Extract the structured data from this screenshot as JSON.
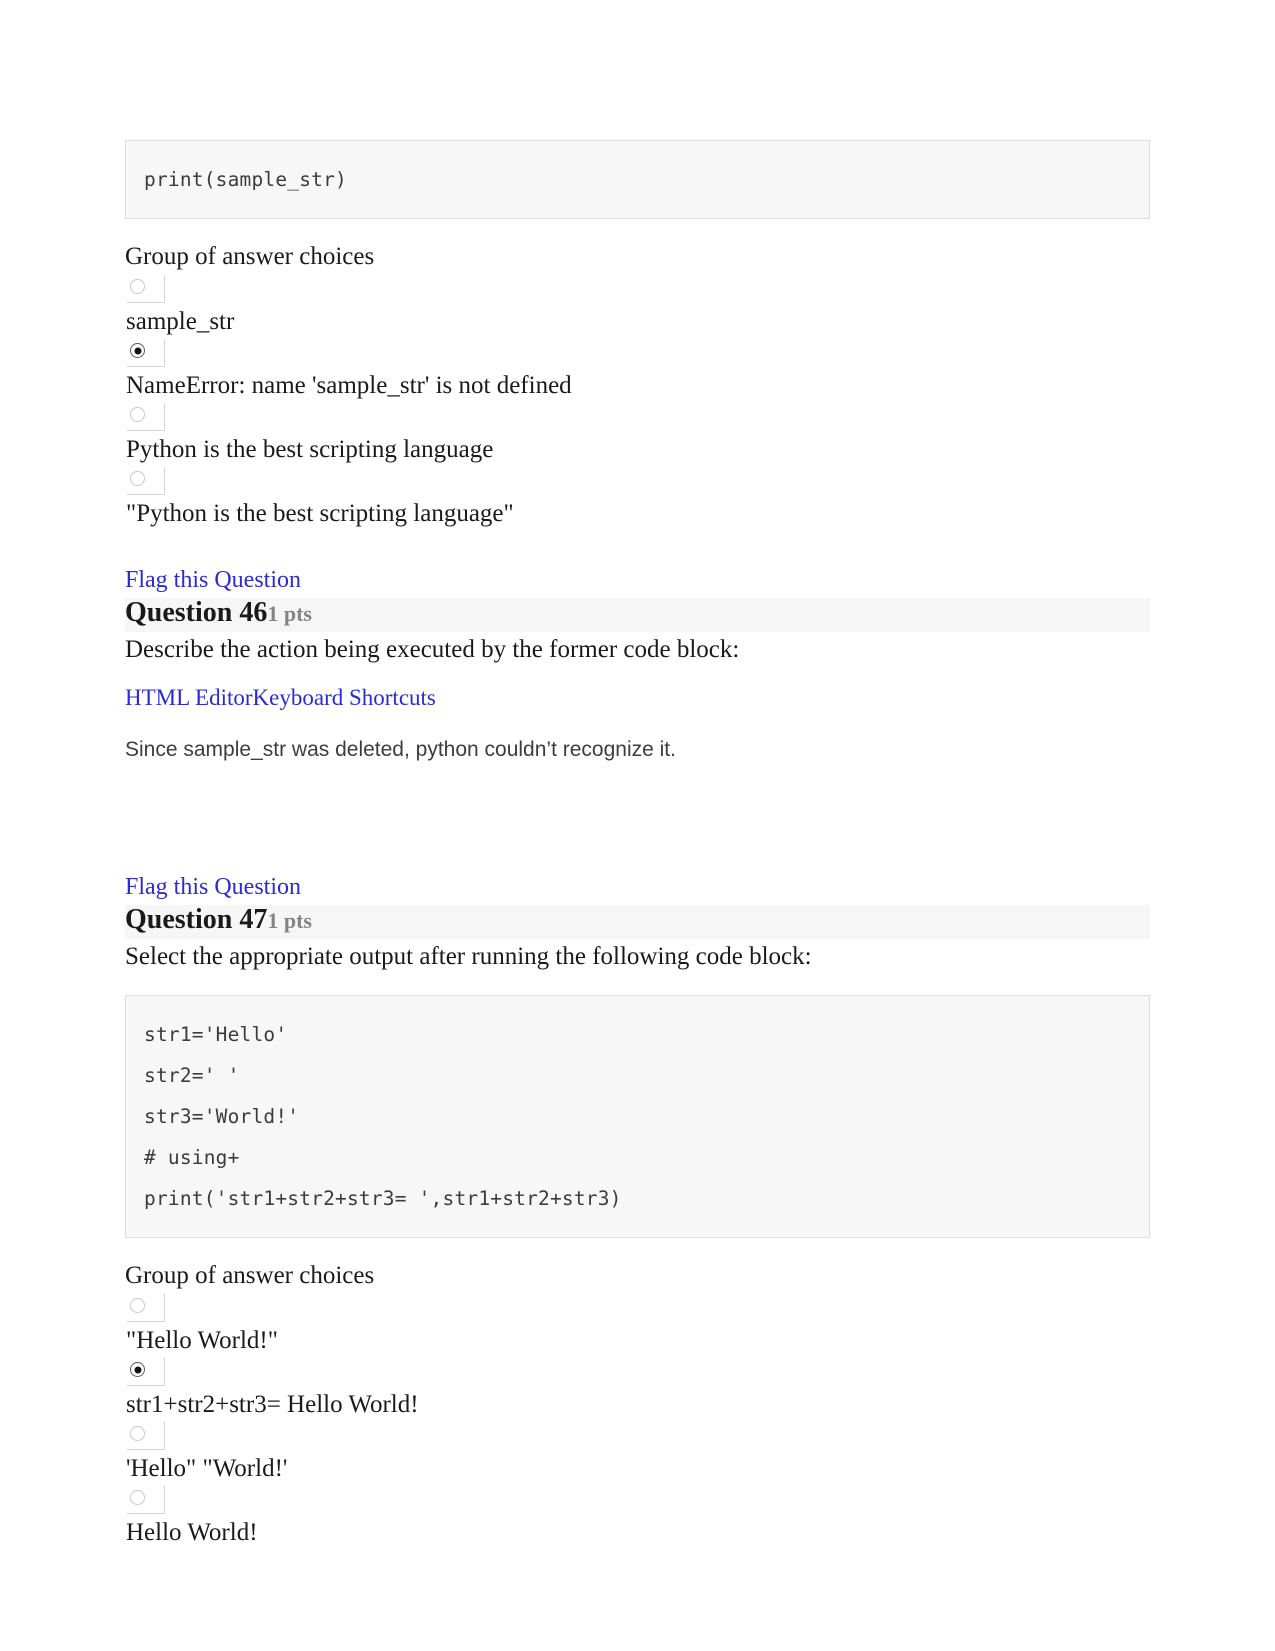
{
  "question45_tail": {
    "code_lines": [
      "print(sample_str)"
    ],
    "group_label": "Group of answer choices",
    "choices": [
      {
        "text": "sample_str",
        "selected": false
      },
      {
        "text": "NameError: name 'sample_str' is not defined",
        "selected": true
      },
      {
        "text": "Python is the best scripting language",
        "selected": false
      },
      {
        "text": "\"Python is the best scripting language\"",
        "selected": false
      }
    ]
  },
  "question46": {
    "flag_label": "Flag this Question",
    "title": "Question 46",
    "points": "1 pts",
    "prompt": "Describe the action being executed by the former code block:",
    "editor_link": "HTML Editor",
    "shortcuts_link": "Keyboard Shortcuts",
    "answer_text": "Since sample_str was deleted, python couldn’t recognize it."
  },
  "question47": {
    "flag_label": "Flag this Question",
    "title": "Question 47",
    "points": "1 pts",
    "prompt": "Select the appropriate output after running the following code block:",
    "code_lines": [
      "str1='Hello'",
      "str2=' '",
      "str3='World!'",
      "# using+",
      "print('str1+str2+str3= ',str1+str2+str3)"
    ],
    "group_label": "Group of answer choices",
    "choices": [
      {
        "text": "\"Hello World!\"",
        "selected": false
      },
      {
        "text": "str1+str2+str3= Hello World!",
        "selected": true
      },
      {
        "text": "'Hello\" \"World!'",
        "selected": false
      },
      {
        "text": "Hello World!",
        "selected": false
      }
    ]
  },
  "colors": {
    "link": "#2b2bd4",
    "code_bg": "#f7f7f7",
    "header_bg": "#f6f6f6",
    "points_gray": "#848484"
  }
}
